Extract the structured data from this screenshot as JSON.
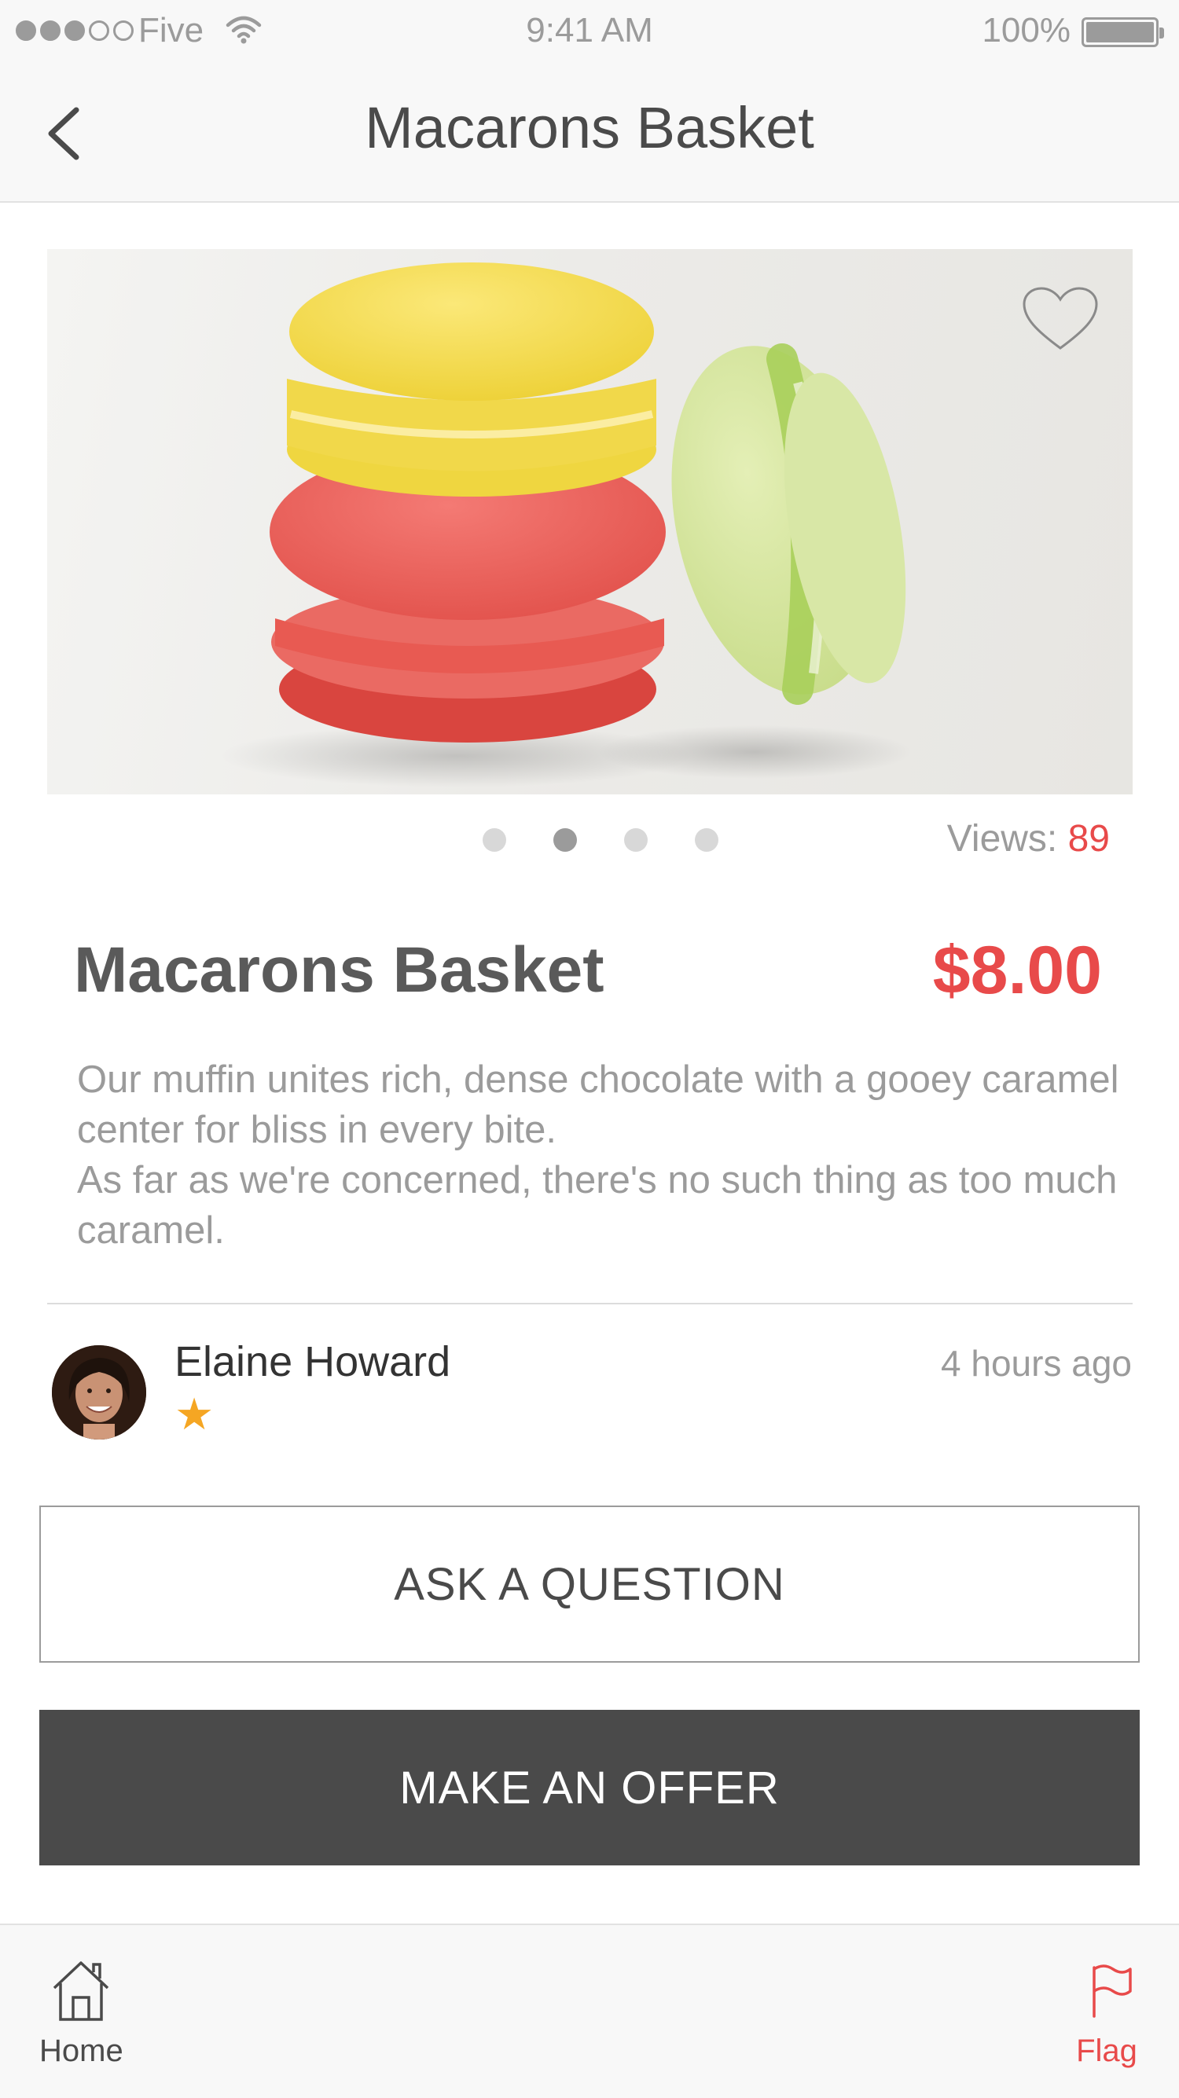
{
  "status_bar": {
    "carrier": "Five",
    "time": "9:41 AM",
    "battery": "100%",
    "icons": [
      "signal-dots",
      "wifi-icon",
      "battery-icon"
    ]
  },
  "nav": {
    "title": "Macarons Basket",
    "back_icon": "chevron-left-icon"
  },
  "gallery": {
    "image": "macarons-photo",
    "favorite_icon": "heart-outline-icon",
    "page_count": 4,
    "active_page": 2
  },
  "views": {
    "label": "Views:",
    "count": "89"
  },
  "product": {
    "title": "Macarons Basket",
    "price": "$8.00",
    "description_lines": [
      "Our muffin unites rich, dense chocolate with a gooey caramel center for bliss in every bite.",
      "As far as we're concerned, there's no such thing as too much caramel."
    ]
  },
  "seller": {
    "name": "Elaine Howard",
    "rating_star": "★",
    "rating": 1,
    "posted": "4 hours ago"
  },
  "actions": {
    "ask": "ASK A QUESTION",
    "offer": "MAKE AN OFFER"
  },
  "tab_bar": {
    "home_label": "Home",
    "flag_label": "Flag"
  },
  "colors": {
    "accent": "#e84a4a",
    "dark_button": "#4a4a4a",
    "star": "#f5a623",
    "muted": "#9b9b9b"
  }
}
